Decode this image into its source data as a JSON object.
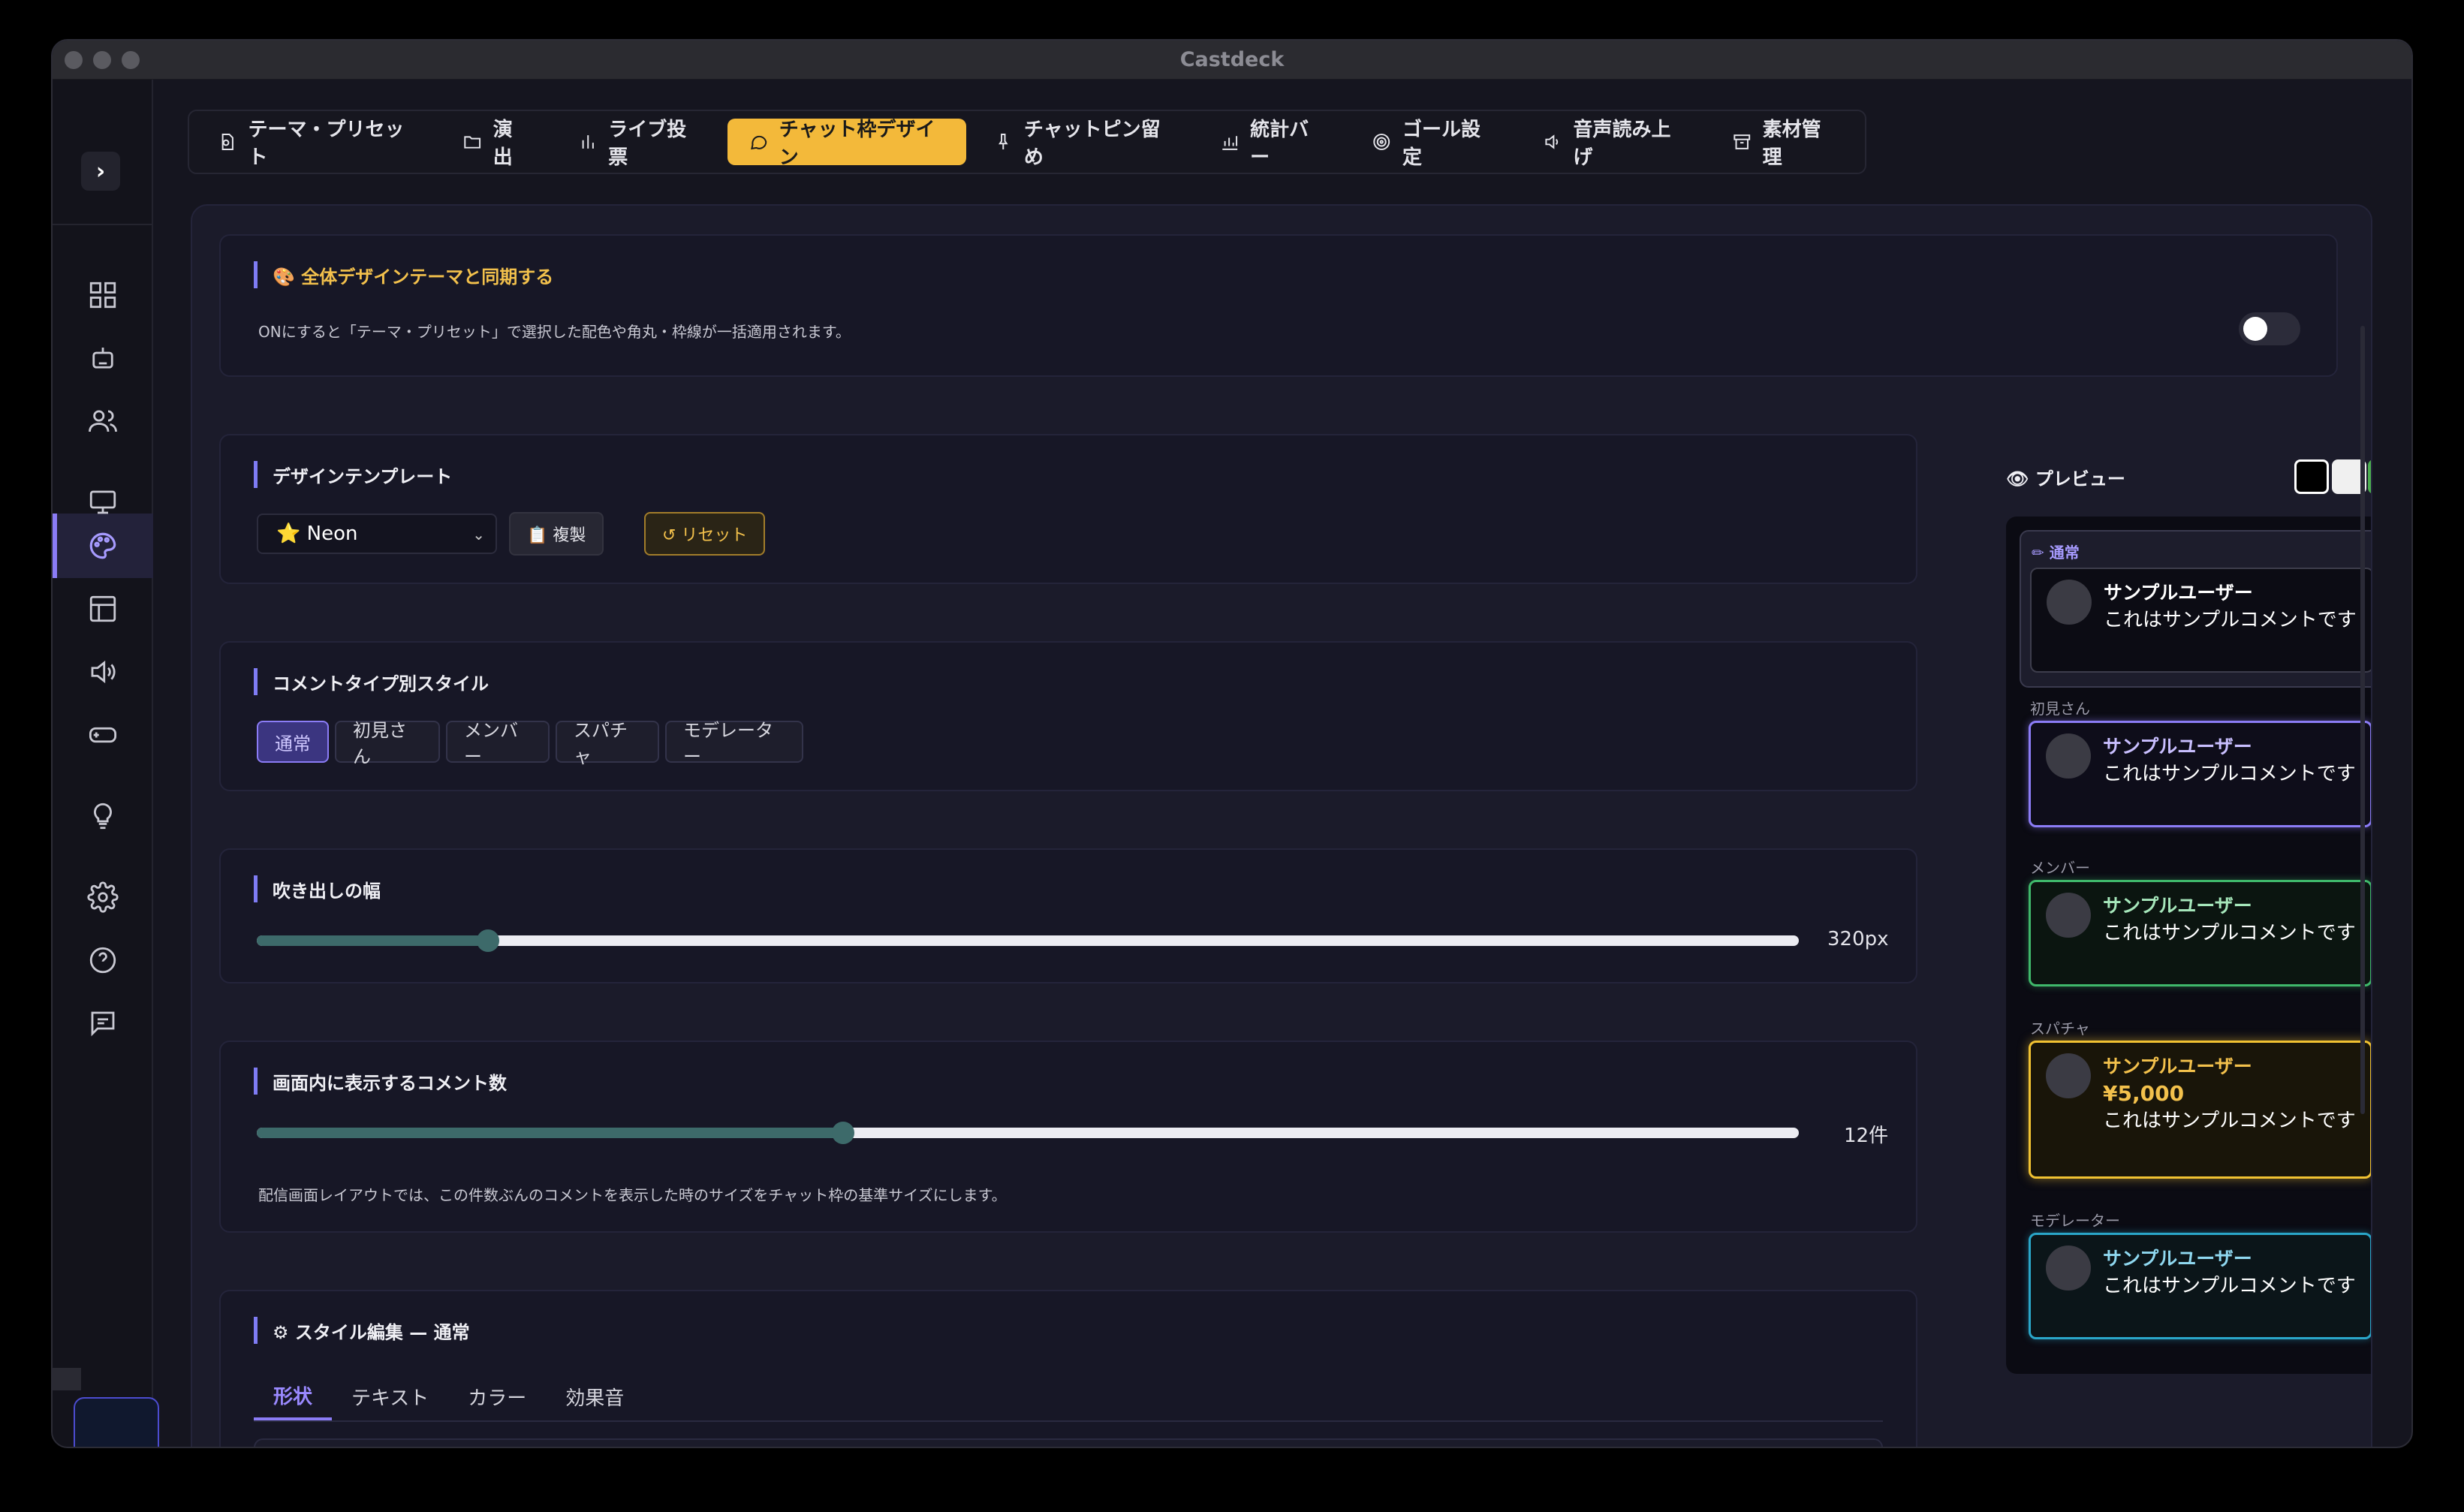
{
  "window": {
    "title": "Castdeck"
  },
  "colors": {
    "accent": "#f3b93a",
    "purple": "#8b7cf6",
    "slider": "#3d6a6a"
  },
  "sidebar": {
    "toggle_icon": "chevron-right-icon",
    "icons": [
      "dashboard-icon",
      "robot-icon",
      "users-icon",
      "monitor-icon",
      "palette-icon",
      "layout-icon",
      "speaker-icon",
      "gamepad-icon",
      "bulb-icon",
      "gear-icon",
      "help-icon",
      "message-icon"
    ],
    "active_item": "palette-icon"
  },
  "tabs": [
    {
      "label": "テーマ・プリセット",
      "icon": "palette-icon"
    },
    {
      "label": "演出",
      "icon": "folder-icon"
    },
    {
      "label": "ライブ投票",
      "icon": "bar-chart-icon"
    },
    {
      "label": "チャット枠デザイン",
      "icon": "chat-bubble-icon",
      "active": true
    },
    {
      "label": "チャットピン留め",
      "icon": "pin-icon"
    },
    {
      "label": "統計バー",
      "icon": "stats-icon"
    },
    {
      "label": "ゴール設定",
      "icon": "target-icon"
    },
    {
      "label": "音声読み上げ",
      "icon": "speaker-icon"
    },
    {
      "label": "素材管理",
      "icon": "archive-icon"
    }
  ],
  "sync": {
    "title": "🎨 全体デザインテーマと同期する",
    "description": "ONにすると「テーマ・プリセット」で選択した配色や角丸・枠線が一括適用されます。",
    "enabled": false
  },
  "template": {
    "title": "デザインテンプレート",
    "selected": "⭐ Neon",
    "duplicate_label": "📋 複製",
    "reset_label": "↺ リセット"
  },
  "comment_types": {
    "title": "コメントタイプ別スタイル",
    "items": [
      "通常",
      "初見さん",
      "メンバー",
      "スパチャ",
      "モデレーター"
    ],
    "active": "通常"
  },
  "bubble_width": {
    "title": "吹き出しの幅",
    "value_label": "320px",
    "fraction": 0.15
  },
  "comment_count": {
    "title": "画面内に表示するコメント数",
    "value_label": "12件",
    "fraction": 0.38,
    "description": "配信画面レイアウトでは、この件数ぶんのコメントを表示した時のサイズをチャット枠の基準サイズにします。"
  },
  "style_edit": {
    "title": "⚙ スタイル編集 — 通常",
    "subtabs": [
      "形状",
      "テキスト",
      "カラー",
      "効果音"
    ],
    "active": "形状"
  },
  "preview": {
    "title": "👁 プレビュー",
    "swatches": [
      "#000000",
      "#f0f0f0",
      "#4caf50"
    ],
    "groups": [
      {
        "label": "✏ 通常",
        "user": "サンプルユーザー",
        "comment": "これはサンプルコメントです"
      },
      {
        "label": "初見さん",
        "user": "サンプルユーザー",
        "comment": "これはサンプルコメントです"
      },
      {
        "label": "メンバー",
        "user": "サンプルユーザー",
        "comment": "これはサンプルコメントです"
      },
      {
        "label": "スパチャ",
        "user": "サンプルユーザー",
        "amount": "¥5,000",
        "comment": "これはサンプルコメントです"
      },
      {
        "label": "モデレーター",
        "user": "サンプルユーザー",
        "comment": "これはサンプルコメントです"
      }
    ]
  }
}
